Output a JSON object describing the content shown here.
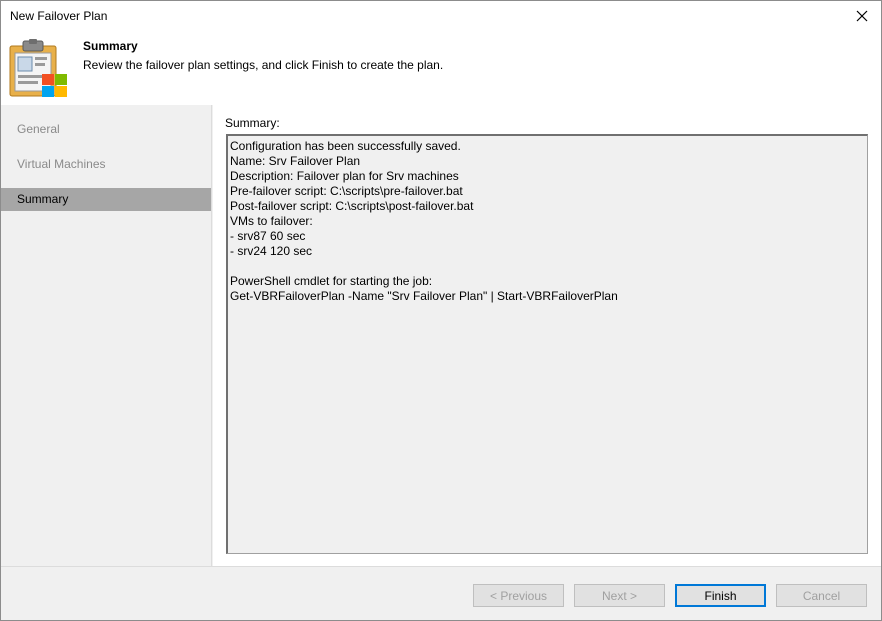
{
  "window": {
    "title": "New Failover Plan"
  },
  "header": {
    "title": "Summary",
    "description": "Review the failover plan settings, and click Finish to create the plan.",
    "icon": "failover-plan-clipboard-icon"
  },
  "sidebar": {
    "items": [
      {
        "label": "General",
        "active": false
      },
      {
        "label": "Virtual Machines",
        "active": false
      },
      {
        "label": "Summary",
        "active": true
      }
    ]
  },
  "content": {
    "summary_label": "Summary:",
    "summary_lines": [
      "Configuration has been successfully saved.",
      "Name: Srv Failover Plan",
      "Description: Failover plan for Srv machines",
      "Pre-failover script: C:\\scripts\\pre-failover.bat",
      "Post-failover script: C:\\scripts\\post-failover.bat",
      "VMs to failover:",
      "- srv87 60 sec",
      "- srv24 120 sec",
      "",
      "PowerShell cmdlet for starting the job:",
      "Get-VBRFailoverPlan -Name \"Srv Failover Plan\" | Start-VBRFailoverPlan"
    ]
  },
  "footer": {
    "previous_label": "< Previous",
    "next_label": "Next >",
    "finish_label": "Finish",
    "cancel_label": "Cancel"
  },
  "colors": {
    "sidebar_active": "#a6a6a6",
    "primary_border": "#0078d7",
    "panel_bg": "#f0f0f0"
  }
}
